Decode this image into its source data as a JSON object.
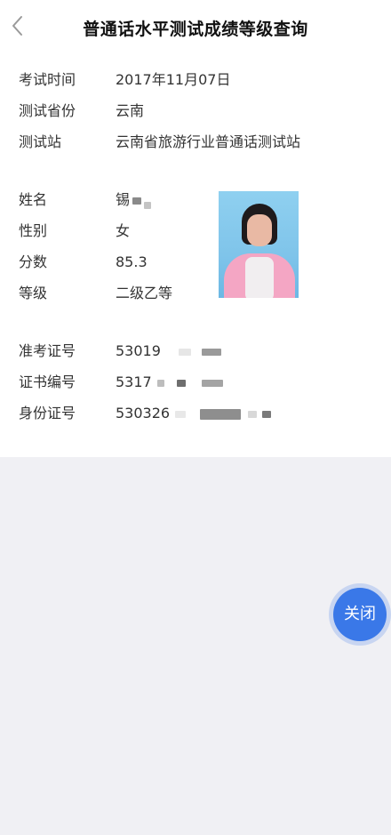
{
  "header": {
    "title": "普通话水平测试成绩等级查询",
    "back_icon": "chevron-left-icon"
  },
  "exam": {
    "time_label": "考试时间",
    "time_value": "2017年11月07日",
    "province_label": "测试省份",
    "province_value": "云南",
    "station_label": "测试站",
    "station_value": "云南省旅游行业普通话测试站"
  },
  "person": {
    "name_label": "姓名",
    "name_value": "锡",
    "gender_label": "性别",
    "gender_value": "女",
    "score_label": "分数",
    "score_value": "85.3",
    "grade_label": "等级",
    "grade_value": "二级乙等"
  },
  "ids": {
    "ticket_label": "准考证号",
    "ticket_value": "53019",
    "certificate_label": "证书编号",
    "certificate_value": "5317",
    "idcard_label": "身份证号",
    "idcard_value": "530326"
  },
  "actions": {
    "close_label": "关闭"
  },
  "colors": {
    "accent": "#3a78e8",
    "background": "#f0f0f4",
    "card": "#ffffff"
  }
}
